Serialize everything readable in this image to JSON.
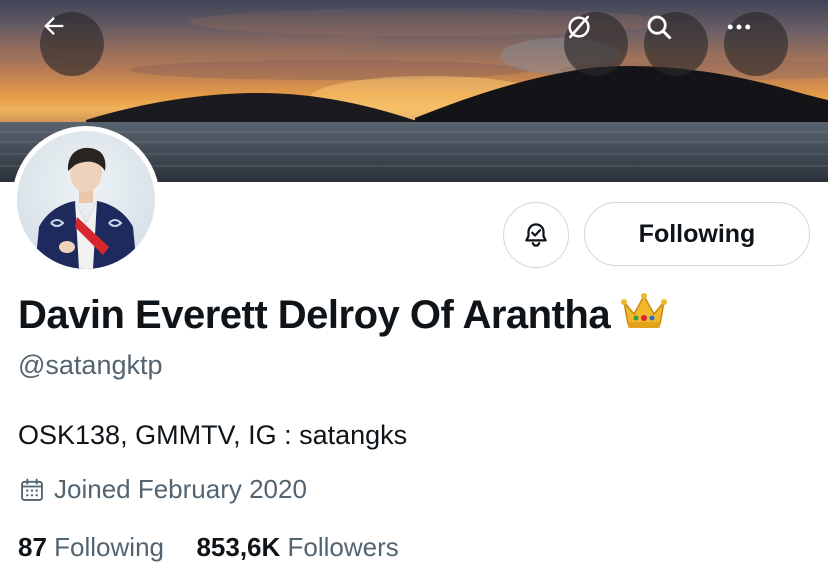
{
  "header": {
    "back_icon": "arrow-left-icon",
    "translate_icon": "globe-slash-icon",
    "search_icon": "search-icon",
    "more_icon": "more-horizontal-icon"
  },
  "profile": {
    "display_name": "Davin Everett Delroy Of Arantha",
    "name_emoji": "crown",
    "handle": "@satangktp",
    "bio": "OSK138, GMMTV, IG : satangks",
    "joined": "Joined February 2020",
    "following_count": "87",
    "following_label": "Following",
    "followers_count": "853,6K",
    "followers_label": "Followers"
  },
  "actions": {
    "notify_icon": "bell-check-icon",
    "following_button_label": "Following"
  },
  "colors": {
    "text_primary": "#0f1419",
    "text_secondary": "#536471",
    "border": "#cfd9de"
  }
}
